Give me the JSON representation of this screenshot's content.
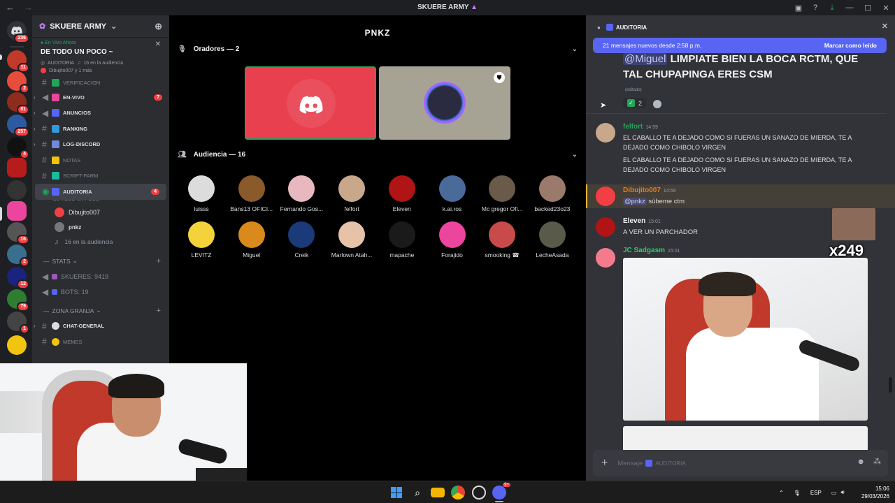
{
  "window": {
    "title": "SKUERE ARMY"
  },
  "rail": {
    "badges": [
      "236",
      "11",
      "2",
      "81",
      "257",
      "4",
      "16",
      "2",
      "12",
      "79",
      "1"
    ]
  },
  "sidebar": {
    "server_name": "SKUERE ARMY",
    "live_label": "En Vivo Ahora",
    "live_title": "DE TODO UN POCO ~",
    "live_channel": "AUDITORIA",
    "live_audience": "16 en la audiencia",
    "live_users": "Dibujito007 y 1 más",
    "channels": [
      {
        "name": "VERIFICACION",
        "type": "text",
        "muted": true
      },
      {
        "name": "EN-VIVO",
        "type": "announce",
        "badge": "7"
      },
      {
        "name": "ANUNCIOS",
        "type": "announce"
      },
      {
        "name": "RANKING",
        "type": "text"
      },
      {
        "name": "LOG-DISCORD",
        "type": "text"
      },
      {
        "name": "NOTAS",
        "type": "text",
        "muted": true
      },
      {
        "name": "SCRIPT-FARM",
        "type": "text",
        "muted": true
      }
    ],
    "active_stage": {
      "name": "AUDITORIA",
      "sub": "DE TODO UN POCO ~",
      "badge": "4"
    },
    "stage_users": [
      "Dibujito007",
      "pnkz"
    ],
    "stage_audience": "16 en la audiencia",
    "cat_stats": "STATS",
    "stats_members": "SKUERES: 9419",
    "stats_bots": "BOTS: 19",
    "cat_granja": "ZONA GRANJA",
    "granja_channels": [
      "CHAT-GENERAL",
      "MEMES"
    ]
  },
  "stage": {
    "logo": "PNKZ",
    "speakers_label": "Oradores — 2",
    "audience_label": "Audiencia — 16",
    "audience": [
      {
        "name": "luisss",
        "color": "#dcdcdc"
      },
      {
        "name": "Bans13 OFICI...",
        "color": "#8a5a2b"
      },
      {
        "name": "Fernando Gos...",
        "color": "#e8b8c0"
      },
      {
        "name": "felfort",
        "color": "#c9a78b"
      },
      {
        "name": "Eleven",
        "color": "#b01414"
      },
      {
        "name": "k.ai.ros",
        "color": "#4a6b9a"
      },
      {
        "name": "Mc gregor Ofi...",
        "color": "#6a5a4a"
      },
      {
        "name": "backed23o23",
        "color": "#9a7a6a"
      },
      {
        "name": "LEVITZ",
        "color": "#f4d23a"
      },
      {
        "name": "Miguel",
        "color": "#d98a1a"
      },
      {
        "name": "Creik",
        "color": "#1a3a7a"
      },
      {
        "name": "Marlown Atah...",
        "color": "#e6c2a8"
      },
      {
        "name": "mapache",
        "color": "#1a1a1a"
      },
      {
        "name": "Forajido",
        "color": "#eb459e"
      },
      {
        "name": "smooking ☎",
        "color": "#c84a4a"
      },
      {
        "name": "LecheAsada",
        "color": "#5a5a4a"
      }
    ]
  },
  "chat": {
    "channel": "AUDITORIA",
    "new_messages": "21 mensajes nuevos desde 2:58 p.m.",
    "mark_read": "Marcar como leído",
    "big_mention": "@Miguel",
    "big_text": "LIMPIATE BIEN LA BOCA RCTM, QUE TAL CHUPAPINGA ERES CSM",
    "edited": "(editado)",
    "reaction_count": "2",
    "messages": [
      {
        "author": "felfort",
        "time": "14:59",
        "color": "#e67e22",
        "lines": [
          "EL CABALLO TE A DEJADO COMO SI FUERAS UN SANAZO DE MIERDA, TE A DEJADO COMO CHIBOLO VIRGEN",
          "EL CABALLO TE A DEJADO COMO SI FUERAS UN SANAZO DE MIERDA, TE A DEJADO COMO CHIBOLO VIRGEN"
        ]
      },
      {
        "author": "Dibujito007",
        "time": "14:59",
        "color": "#e67e22",
        "mention": "@pnkz",
        "text": "súbeme ctm"
      },
      {
        "author": "Eleven",
        "time": "15:01",
        "color": "#f2f3f5",
        "text": "A VER UN PARCHADOR"
      },
      {
        "author": "JC Sadgasm",
        "time": "15:01",
        "color": "#2ecc71"
      }
    ],
    "overlay_count": "x249",
    "composer_placeholder": "Mensaje",
    "composer_channel": "AUDITORIA"
  },
  "taskbar": {
    "lang": "ESP",
    "time": "15:06",
    "date": "29/03/2026",
    "discord_badge": "9+"
  }
}
